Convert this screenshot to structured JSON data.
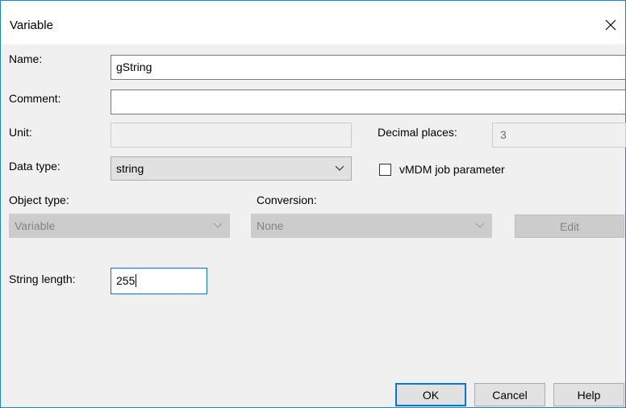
{
  "window": {
    "title": "Variable"
  },
  "fields": {
    "name": {
      "label": "Name:",
      "value": "gString"
    },
    "comment": {
      "label": "Comment:",
      "value": ""
    },
    "unit": {
      "label": "Unit:",
      "value": ""
    },
    "decimal_places": {
      "label": "Decimal places:",
      "value": "3"
    },
    "data_type": {
      "label": "Data type:",
      "selected": "string"
    },
    "vmdm_job_parameter": {
      "label": "vMDM job parameter",
      "checked": false
    },
    "object_type": {
      "label": "Object type:",
      "selected": "Variable"
    },
    "conversion": {
      "label": "Conversion:",
      "selected": "None"
    },
    "edit_button": {
      "label": "Edit"
    },
    "string_length": {
      "label": "String length:",
      "value": "255"
    }
  },
  "buttons": {
    "ok": "OK",
    "cancel": "Cancel",
    "help": "Help"
  },
  "icons": {
    "close": "close-icon",
    "dropdown": "chevron-down-icon"
  },
  "colors": {
    "accent": "#0078d7",
    "border": "#1883d7",
    "background": "#f0f0f0"
  }
}
